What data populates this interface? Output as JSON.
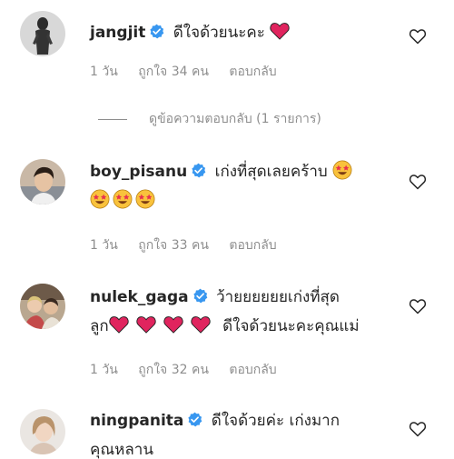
{
  "comments": [
    {
      "username": "jangjit",
      "text": "ดีใจด้วยนะคะ",
      "line2": "",
      "meta": {
        "age": "1 วัน",
        "likes": "ถูกใจ 34 คน",
        "reply": "ตอบกลับ"
      },
      "avatar_icon": "dark-figure-avatar"
    },
    {
      "username": "boy_pisanu",
      "text": "เก่งที่สุดเลยคร้าบ",
      "line2": "",
      "meta": {
        "age": "1 วัน",
        "likes": "ถูกใจ 33 คน",
        "reply": "ตอบกลับ"
      },
      "avatar_icon": "man-portrait-avatar"
    },
    {
      "username": "nulek_gaga",
      "text": "ว้ายยยยยยเก่งที่สุด",
      "line2_prefix": "ลูก",
      "line2_suffix": "ดีใจด้วยนะคะคุณแม่",
      "meta": {
        "age": "1 วัน",
        "likes": "ถูกใจ 32 คน",
        "reply": "ตอบกลับ"
      },
      "avatar_icon": "group-photo-avatar"
    },
    {
      "username": "ningpanita",
      "text": "ดีใจด้วยค่ะ เก่งมาก",
      "line2": "คุณหลาน",
      "avatar_icon": "woman-portrait-avatar"
    }
  ],
  "view_replies_label": "ดูข้อความตอบกลับ (1 รายการ)",
  "colors": {
    "text": "#262626",
    "secondary": "#8e8e8e",
    "verified": "#3897f0",
    "heart": "#e0245e"
  },
  "icons": {
    "verified": "verified-badge-icon",
    "heart": "red-heart-emoji",
    "star_struck": "star-struck-emoji",
    "like": "heart-outline-icon"
  }
}
